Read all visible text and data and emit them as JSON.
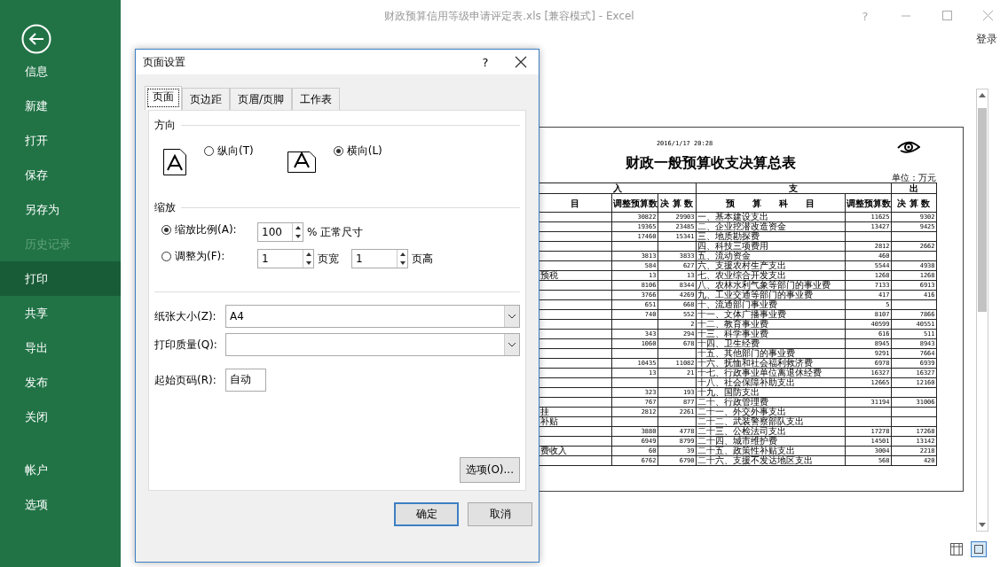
{
  "window": {
    "title": "财政预算信用等级申请评定表.xls  [兼容模式] - Excel",
    "help": "?",
    "sign_in": "登录"
  },
  "sidebar": {
    "items": [
      {
        "label": "信息",
        "selected": false,
        "disabled": false
      },
      {
        "label": "新建",
        "selected": false,
        "disabled": false
      },
      {
        "label": "打开",
        "selected": false,
        "disabled": false
      },
      {
        "label": "保存",
        "selected": false,
        "disabled": false
      },
      {
        "label": "另存为",
        "selected": false,
        "disabled": false
      },
      {
        "label": "历史记录",
        "selected": false,
        "disabled": true
      },
      {
        "label": "打印",
        "selected": true,
        "disabled": false
      },
      {
        "label": "共享",
        "selected": false,
        "disabled": false
      },
      {
        "label": "导出",
        "selected": false,
        "disabled": false
      },
      {
        "label": "发布",
        "selected": false,
        "disabled": false
      },
      {
        "label": "关闭",
        "selected": false,
        "disabled": false
      },
      {
        "label": "帐户",
        "selected": false,
        "disabled": false
      },
      {
        "label": "选项",
        "selected": false,
        "disabled": false
      }
    ]
  },
  "dialog": {
    "title": "页面设置",
    "help": "?",
    "tabs": [
      {
        "label": "页面",
        "selected": true
      },
      {
        "label": "页边距",
        "selected": false
      },
      {
        "label": "页眉/页脚",
        "selected": false
      },
      {
        "label": "工作表",
        "selected": false
      }
    ],
    "orientation": {
      "heading": "方向",
      "options": [
        {
          "label": "纵向(T)",
          "selected": false
        },
        {
          "label": "横向(L)",
          "selected": true
        }
      ]
    },
    "scaling": {
      "heading": "缩放",
      "options": [
        {
          "kind": "percent",
          "label": "缩放比例(A):",
          "selected": true,
          "value": "100",
          "suffix": "% 正常尺寸"
        },
        {
          "kind": "fit",
          "label": "调整为(F):",
          "selected": false,
          "wide": "1",
          "wide_label": "页宽",
          "tall": "1",
          "tall_label": "页高"
        }
      ]
    },
    "fields": [
      {
        "kind": "dropdown",
        "label": "纸张大小(Z):",
        "value": "A4"
      },
      {
        "kind": "dropdown",
        "label": "打印质量(Q):"
      },
      {
        "kind": "text",
        "label": "起始页码(R):",
        "value": "自动"
      }
    ],
    "options_button": "选项(O)...",
    "ok": "确定",
    "cancel": "取消"
  },
  "preview": {
    "timestamp": "2016/1/17 20:28",
    "title": "财政一般预算收支决算总表",
    "unit": "单位：万元",
    "groups": [
      "入",
      "支",
      "出"
    ],
    "columns": [
      "目",
      "调整预算数",
      "决 算 数",
      "预　　算　　科　　目",
      "调整预算数",
      "决 算 数"
    ],
    "rows": [
      [
        null,
        "30822",
        "29903",
        "一、基本建设支出",
        "11625",
        "9302"
      ],
      [
        null,
        "19365",
        "23485",
        "二、企业挖潜改造资金",
        "13427",
        "9425"
      ],
      [
        null,
        "17460",
        "15341",
        "三、地质勘探费",
        null,
        null
      ],
      [
        null,
        null,
        null,
        "四、科技三项费用",
        "2812",
        "2662"
      ],
      [
        null,
        "3813",
        "3833",
        "五、流动资金",
        "460",
        null
      ],
      [
        null,
        "584",
        "627",
        "六、支援农村生产支出",
        "5544",
        "4938"
      ],
      [
        "预税",
        "13",
        "13",
        "七、农业综合开发支出",
        "1268",
        "1268"
      ],
      [
        null,
        "8106",
        "8344",
        "八、农林水利气象等部门的事业费",
        "7133",
        "6913"
      ],
      [
        null,
        "3766",
        "4269",
        "九、工业交通等部门的事业费",
        "417",
        "416"
      ],
      [
        null,
        "651",
        "668",
        "十、流通部门事业费",
        "5",
        null
      ],
      [
        null,
        "740",
        "552",
        "十一、文体广播事业费",
        "8107",
        "7866"
      ],
      [
        null,
        null,
        "2",
        "十二、教育事业费",
        "40599",
        "40551"
      ],
      [
        null,
        "343",
        "294",
        "十三、科学事业费",
        "616",
        "511"
      ],
      [
        null,
        "1060",
        "678",
        "十四、卫生经费",
        "8945",
        "8943"
      ],
      [
        null,
        null,
        null,
        "十五、其他部门的事业费",
        "9291",
        "7664"
      ],
      [
        null,
        "10435",
        "11082",
        "十六、抚恤和社会福利救济费",
        "6978",
        "6939"
      ],
      [
        null,
        "13",
        "21",
        "十七、行政事业单位离退休经费",
        "16327",
        "16327"
      ],
      [
        null,
        null,
        null,
        "十八、社会保障补助支出",
        "12665",
        "12160"
      ],
      [
        null,
        "323",
        "193",
        "十九、国防支出",
        null,
        null
      ],
      [
        null,
        "767",
        "877",
        "二十、行政管理费",
        "31194",
        "31006"
      ],
      [
        "挂",
        "2812",
        "2261",
        "二十一、外交外事支出",
        null,
        null
      ],
      [
        "补贴",
        null,
        null,
        "二十二、武装警察部队支出",
        null,
        null
      ],
      [
        null,
        "3880",
        "4778",
        "二十三、公检法司支出",
        "17278",
        "17268"
      ],
      [
        null,
        "6949",
        "8799",
        "二十四、城市维护费",
        "14501",
        "13142"
      ],
      [
        "费收入",
        "60",
        "39",
        "二十五、政策性补贴支出",
        "3004",
        "2218"
      ],
      [
        null,
        "6762",
        "6790",
        "二十六、支援不发达地区支出",
        "568",
        "420"
      ]
    ]
  }
}
